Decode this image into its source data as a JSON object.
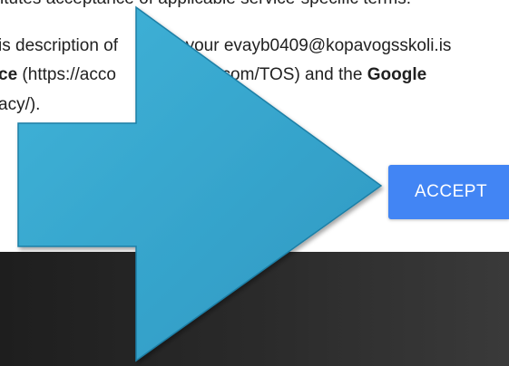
{
  "terms": {
    "line0": "itutes acceptance of applicable service-specific terms.",
    "line1_pre": "is description of",
    "line1_post": "your evayb0409@kopavogsskoli.is",
    "line2_bold1": "ce",
    "line2_mid1": " (https://acco",
    "line2_mid2": "gle.com/TOS) and the ",
    "line2_bold2": "Google",
    "line3": "acy/)."
  },
  "actions": {
    "accept_label": "ACCEPT"
  },
  "overlay": {
    "icon": "right-arrow-icon",
    "color": "#34a5cf"
  },
  "colors": {
    "accent": "#4285f4",
    "scrim": "#2a2a2a"
  }
}
